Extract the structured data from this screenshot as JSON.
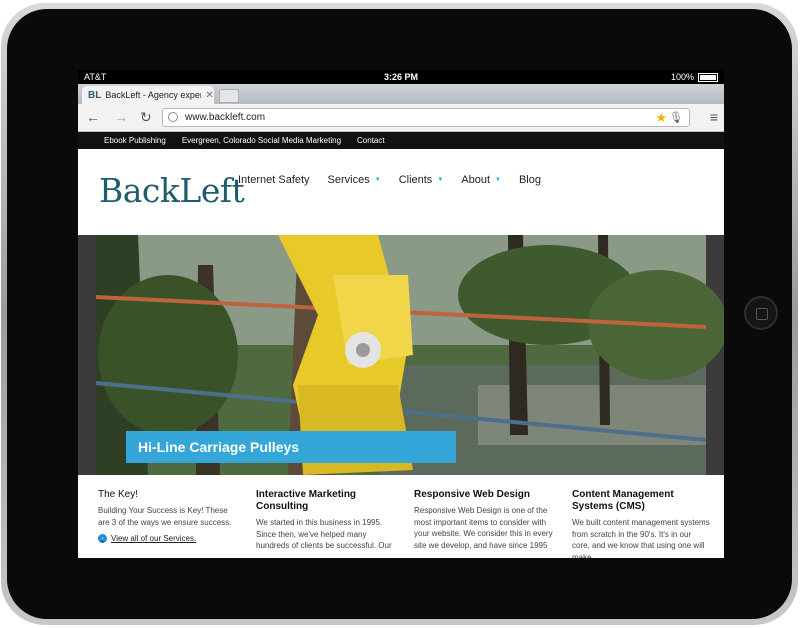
{
  "status_bar": {
    "carrier": "AT&T",
    "time": "3:26 PM",
    "battery": "100%"
  },
  "browser": {
    "tab": {
      "favicon": "BL",
      "title": "BackLeft - Agency expertise"
    },
    "address": {
      "url": "www.backleft.com"
    },
    "icons": [
      "back-arrow-icon",
      "forward-arrow-icon",
      "reload-icon",
      "globe-icon",
      "star-icon",
      "microphone-icon",
      "menu-icon"
    ],
    "colors": {
      "star": "#f0b400"
    }
  },
  "utility_nav": [
    "Ebook Publishing",
    "Evergreen, Colorado Social Media Marketing",
    "Contact"
  ],
  "site": {
    "logo": "BackLeft",
    "nav": [
      {
        "label": "Internet Safety",
        "dropdown": false
      },
      {
        "label": "Services",
        "dropdown": true
      },
      {
        "label": "Clients",
        "dropdown": true
      },
      {
        "label": "About",
        "dropdown": true
      },
      {
        "label": "Blog",
        "dropdown": false
      }
    ],
    "colors": {
      "accent": "#34a6d8",
      "logo": "#1f5d6d"
    }
  },
  "hero": {
    "caption": "Hi-Line Carriage Pulleys"
  },
  "columns": [
    {
      "title": "The Key!",
      "body": "Building Your Success is Key! These are 3 of the ways we ensure success.",
      "link": "View all of our Services."
    },
    {
      "title": "Interactive Marketing Consulting",
      "body": "We started in this business in 1995. Since then, we've helped many hundreds of clients be successful. Our"
    },
    {
      "title": "Responsive Web Design",
      "body": "Responsive Web Design is one of the most important items to consider with your website. We consider this in every site we develop, and have since 1995"
    },
    {
      "title": "Content Management Systems (CMS)",
      "body": "We built content management systems from scratch in the 90's. It's in our core, and we know that using one will make"
    }
  ]
}
